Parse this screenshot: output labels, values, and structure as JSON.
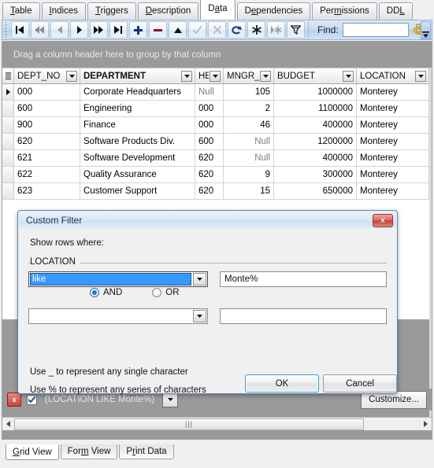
{
  "window": {
    "top_tabs": [
      {
        "label": "Table",
        "accel": "T",
        "active": false
      },
      {
        "label": "Indices",
        "accel": "I",
        "active": false
      },
      {
        "label": "Triggers",
        "accel": "T",
        "active": false
      },
      {
        "label": "Description",
        "accel": "D",
        "active": false
      },
      {
        "label": "Data",
        "accel": "a",
        "active": true
      },
      {
        "label": "Dependencies",
        "accel": "e",
        "active": false
      },
      {
        "label": "Permissions",
        "accel": "m",
        "active": false
      },
      {
        "label": "DDL",
        "accel": "L",
        "active": false
      }
    ]
  },
  "toolbar": {
    "buttons": [
      {
        "name": "first-record-button",
        "icon": "first"
      },
      {
        "name": "prior-page-button",
        "icon": "prev-fast"
      },
      {
        "name": "prior-record-button",
        "icon": "prev"
      },
      {
        "name": "next-record-button",
        "icon": "next"
      },
      {
        "name": "next-page-button",
        "icon": "next-fast"
      },
      {
        "name": "last-record-button",
        "icon": "last"
      },
      {
        "name": "insert-record-button",
        "icon": "plus"
      },
      {
        "name": "delete-record-button",
        "icon": "minus"
      },
      {
        "name": "edit-record-button",
        "icon": "caret-up"
      },
      {
        "name": "post-edit-button",
        "icon": "check"
      },
      {
        "name": "cancel-edit-button",
        "icon": "cross"
      },
      {
        "name": "refresh-button",
        "icon": "refresh"
      },
      {
        "name": "set-null-button",
        "icon": "asterisk"
      },
      {
        "name": "clear-value-button",
        "icon": "asterisk-small"
      },
      {
        "name": "filter-button",
        "icon": "funnel"
      }
    ],
    "find_label": "Find:",
    "find_value": "",
    "find_placeholder": "",
    "find_icon": "find-records-icon",
    "overflow_icon": "toolbar-overflow-icon"
  },
  "grid": {
    "group_panel_text": "Drag a column header here to group by that column",
    "columns": [
      {
        "label": "DEPT_NO",
        "bold": false,
        "width": 84,
        "align": "left"
      },
      {
        "label": "DEPARTMENT",
        "bold": true,
        "width": 146,
        "align": "left"
      },
      {
        "label": "HE",
        "bold": false,
        "width": 36,
        "align": "left"
      },
      {
        "label": "MNGR_N",
        "bold": false,
        "width": 64,
        "align": "right"
      },
      {
        "label": "BUDGET",
        "bold": false,
        "width": 105,
        "align": "right"
      },
      {
        "label": "LOCATION",
        "bold": false,
        "width": 92,
        "align": "left"
      }
    ],
    "rows": [
      {
        "current": true,
        "cells": [
          "000",
          "Corporate Headquarters",
          "Null",
          "105",
          "1000000",
          "Monterey"
        ],
        "null_flags": [
          false,
          false,
          true,
          false,
          false,
          false
        ]
      },
      {
        "current": false,
        "cells": [
          "600",
          "Engineering",
          "000",
          "2",
          "1100000",
          "Monterey"
        ],
        "null_flags": [
          false,
          false,
          false,
          false,
          false,
          false
        ]
      },
      {
        "current": false,
        "cells": [
          "900",
          "Finance",
          "000",
          "46",
          "400000",
          "Monterey"
        ],
        "null_flags": [
          false,
          false,
          false,
          false,
          false,
          false
        ]
      },
      {
        "current": false,
        "cells": [
          "620",
          "Software Products Div.",
          "600",
          "Null",
          "1200000",
          "Monterey"
        ],
        "null_flags": [
          false,
          false,
          false,
          true,
          false,
          false
        ]
      },
      {
        "current": false,
        "cells": [
          "621",
          "Software Development",
          "620",
          "Null",
          "400000",
          "Monterey"
        ],
        "null_flags": [
          false,
          false,
          false,
          true,
          false,
          false
        ]
      },
      {
        "current": false,
        "cells": [
          "622",
          "Quality Assurance",
          "620",
          "9",
          "300000",
          "Monterey"
        ],
        "null_flags": [
          false,
          false,
          false,
          false,
          false,
          false
        ]
      },
      {
        "current": false,
        "cells": [
          "623",
          "Customer Support",
          "620",
          "15",
          "650000",
          "Monterey"
        ],
        "null_flags": [
          false,
          false,
          false,
          false,
          false,
          false
        ]
      }
    ]
  },
  "filter_bar": {
    "close_label": "x",
    "enabled": true,
    "expression": "(LOCATION LIKE Monte%)",
    "customize_label": "Customize..."
  },
  "bottom_tabs": [
    {
      "label": "Grid View",
      "accel": "G",
      "active": true
    },
    {
      "label": "Form View",
      "accel": "m",
      "active": false
    },
    {
      "label": "Print Data",
      "accel": "r",
      "active": false
    }
  ],
  "dialog": {
    "title": "Custom Filter",
    "close_label": "x",
    "show_rows_label": "Show rows where:",
    "group_title": "LOCATION",
    "condition1": {
      "operator": "like",
      "operator_selected": true,
      "value": "Monte%"
    },
    "logic": {
      "and_label": "AND",
      "or_label": "OR",
      "selected": "AND"
    },
    "condition2": {
      "operator": "",
      "value": ""
    },
    "hint1": "Use _ to represent any single character",
    "hint2": "Use % to represent any series of characters",
    "ok_label": "OK",
    "cancel_label": "Cancel"
  },
  "colors": {
    "accent": "#3399ff",
    "grid_bg": "#9a9a9a",
    "toolbar": "#c7dcf2",
    "dialog_border": "#5c86b0",
    "close_red": "#c93f33"
  }
}
